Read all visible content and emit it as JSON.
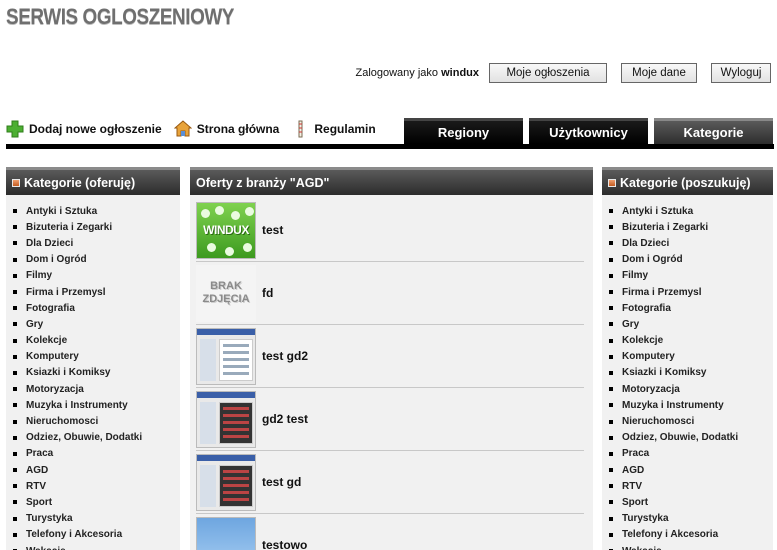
{
  "site": {
    "logo": "SERWIS OGLOSZENIOWY"
  },
  "user": {
    "logged_prefix": "Zalogowany jako",
    "username": "windux",
    "buttons": {
      "my_ads": "Moje ogłoszenia",
      "my_data": "Moje dane",
      "logout": "Wyloguj"
    }
  },
  "toolbar": {
    "add": "Dodaj nowe ogłoszenie",
    "home": "Strona główna",
    "rules": "Regulamin"
  },
  "tabs": [
    {
      "label": "Regiony",
      "active": false
    },
    {
      "label": "Użytkownicy",
      "active": false
    },
    {
      "label": "Kategorie",
      "active": true
    }
  ],
  "left_panel": {
    "title": "Kategorie (oferuję)",
    "items": [
      "Antyki i Sztuka",
      "Bizuteria i Zegarki",
      "Dla Dzieci",
      "Dom i Ogród",
      "Filmy",
      "Firma i Przemysl",
      "Fotografia",
      "Gry",
      "Kolekcje",
      "Komputery",
      "Ksiazki i Komiksy",
      "Motoryzacja",
      "Muzyka i Instrumenty",
      "Nieruchomosci",
      "Odziez, Obuwie, Dodatki",
      "Praca",
      "AGD",
      "RTV",
      "Sport",
      "Turystyka",
      "Telefony i Akcesoria",
      "Wakacje"
    ]
  },
  "right_panel": {
    "title": "Kategorie (poszukuję)",
    "items": [
      "Antyki i Sztuka",
      "Bizuteria i Zegarki",
      "Dla Dzieci",
      "Dom i Ogród",
      "Filmy",
      "Firma i Przemysl",
      "Fotografia",
      "Gry",
      "Kolekcje",
      "Komputery",
      "Ksiazki i Komiksy",
      "Motoryzacja",
      "Muzyka i Instrumenty",
      "Nieruchomosci",
      "Odziez, Obuwie, Dodatki",
      "Praca",
      "AGD",
      "RTV",
      "Sport",
      "Turystyka",
      "Telefony i Akcesoria",
      "Wakacje"
    ]
  },
  "offers_panel": {
    "title": "Oferty z branży \"AGD\"",
    "thumb_windux_text": "WINDUX",
    "thumb_brak_line1": "BRAK",
    "thumb_brak_line2": "ZDJĘCIA",
    "items": [
      {
        "title": "test",
        "thumb": "windux"
      },
      {
        "title": "fd",
        "thumb": "brak"
      },
      {
        "title": "test gd2",
        "thumb": "shot"
      },
      {
        "title": "gd2 test",
        "thumb": "dark"
      },
      {
        "title": "test gd",
        "thumb": "dark"
      },
      {
        "title": "testowo",
        "thumb": "sky"
      }
    ]
  }
}
